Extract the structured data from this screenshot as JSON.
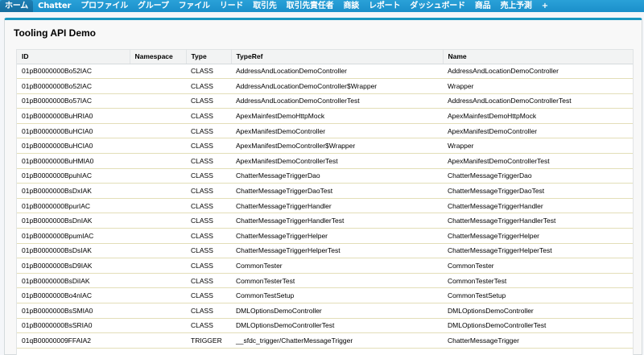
{
  "tabs": [
    {
      "label": "ホーム",
      "active": true
    },
    {
      "label": "Chatter",
      "active": false
    },
    {
      "label": "プロファイル",
      "active": false
    },
    {
      "label": "グループ",
      "active": false
    },
    {
      "label": "ファイル",
      "active": false
    },
    {
      "label": "リード",
      "active": false
    },
    {
      "label": "取引先",
      "active": false
    },
    {
      "label": "取引先責任者",
      "active": false
    },
    {
      "label": "商談",
      "active": false
    },
    {
      "label": "レポート",
      "active": false
    },
    {
      "label": "ダッシュボード",
      "active": false
    },
    {
      "label": "商品",
      "active": false
    },
    {
      "label": "売上予測",
      "active": false
    },
    {
      "label": "+",
      "active": false
    }
  ],
  "panel": {
    "title": "Tooling API Demo"
  },
  "table": {
    "headers": {
      "id": "ID",
      "namespace": "Namespace",
      "type": "Type",
      "typeref": "TypeRef",
      "name": "Name"
    },
    "rows": [
      {
        "id": "01pB0000000Bo52IAC",
        "namespace": "",
        "type": "CLASS",
        "typeref": "AddressAndLocationDemoController",
        "name": "AddressAndLocationDemoController"
      },
      {
        "id": "01pB0000000Bo52IAC",
        "namespace": "",
        "type": "CLASS",
        "typeref": "AddressAndLocationDemoController$Wrapper",
        "name": "Wrapper"
      },
      {
        "id": "01pB0000000Bo57IAC",
        "namespace": "",
        "type": "CLASS",
        "typeref": "AddressAndLocationDemoControllerTest",
        "name": "AddressAndLocationDemoControllerTest"
      },
      {
        "id": "01pB0000000BuHRIA0",
        "namespace": "",
        "type": "CLASS",
        "typeref": "ApexMainfestDemoHttpMock",
        "name": "ApexMainfestDemoHttpMock"
      },
      {
        "id": "01pB0000000BuHCIA0",
        "namespace": "",
        "type": "CLASS",
        "typeref": "ApexManifestDemoController",
        "name": "ApexManifestDemoController"
      },
      {
        "id": "01pB0000000BuHCIA0",
        "namespace": "",
        "type": "CLASS",
        "typeref": "ApexManifestDemoController$Wrapper",
        "name": "Wrapper"
      },
      {
        "id": "01pB0000000BuHMIA0",
        "namespace": "",
        "type": "CLASS",
        "typeref": "ApexManifestDemoControllerTest",
        "name": "ApexManifestDemoControllerTest"
      },
      {
        "id": "01pB0000000BpuhIAC",
        "namespace": "",
        "type": "CLASS",
        "typeref": "ChatterMessageTriggerDao",
        "name": "ChatterMessageTriggerDao"
      },
      {
        "id": "01pB0000000BsDxIAK",
        "namespace": "",
        "type": "CLASS",
        "typeref": "ChatterMessageTriggerDaoTest",
        "name": "ChatterMessageTriggerDaoTest"
      },
      {
        "id": "01pB0000000BpurIAC",
        "namespace": "",
        "type": "CLASS",
        "typeref": "ChatterMessageTriggerHandler",
        "name": "ChatterMessageTriggerHandler"
      },
      {
        "id": "01pB0000000BsDnIAK",
        "namespace": "",
        "type": "CLASS",
        "typeref": "ChatterMessageTriggerHandlerTest",
        "name": "ChatterMessageTriggerHandlerTest"
      },
      {
        "id": "01pB0000000BpumIAC",
        "namespace": "",
        "type": "CLASS",
        "typeref": "ChatterMessageTriggerHelper",
        "name": "ChatterMessageTriggerHelper"
      },
      {
        "id": "01pB0000000BsDsIAK",
        "namespace": "",
        "type": "CLASS",
        "typeref": "ChatterMessageTriggerHelperTest",
        "name": "ChatterMessageTriggerHelperTest"
      },
      {
        "id": "01pB0000000BsD9IAK",
        "namespace": "",
        "type": "CLASS",
        "typeref": "CommonTester",
        "name": "CommonTester"
      },
      {
        "id": "01pB0000000BsDiIAK",
        "namespace": "",
        "type": "CLASS",
        "typeref": "CommonTesterTest",
        "name": "CommonTesterTest"
      },
      {
        "id": "01pB0000000Bo4nIAC",
        "namespace": "",
        "type": "CLASS",
        "typeref": "CommonTestSetup",
        "name": "CommonTestSetup"
      },
      {
        "id": "01pB0000000BsSMIA0",
        "namespace": "",
        "type": "CLASS",
        "typeref": "DMLOptionsDemoController",
        "name": "DMLOptionsDemoController"
      },
      {
        "id": "01pB0000000BsSRIA0",
        "namespace": "",
        "type": "CLASS",
        "typeref": "DMLOptionsDemoControllerTest",
        "name": "DMLOptionsDemoControllerTest"
      },
      {
        "id": "01qB00000009FFAIA2",
        "namespace": "",
        "type": "TRIGGER",
        "typeref": "__sfdc_trigger/ChatterMessageTrigger",
        "name": "ChatterMessageTrigger"
      }
    ]
  }
}
